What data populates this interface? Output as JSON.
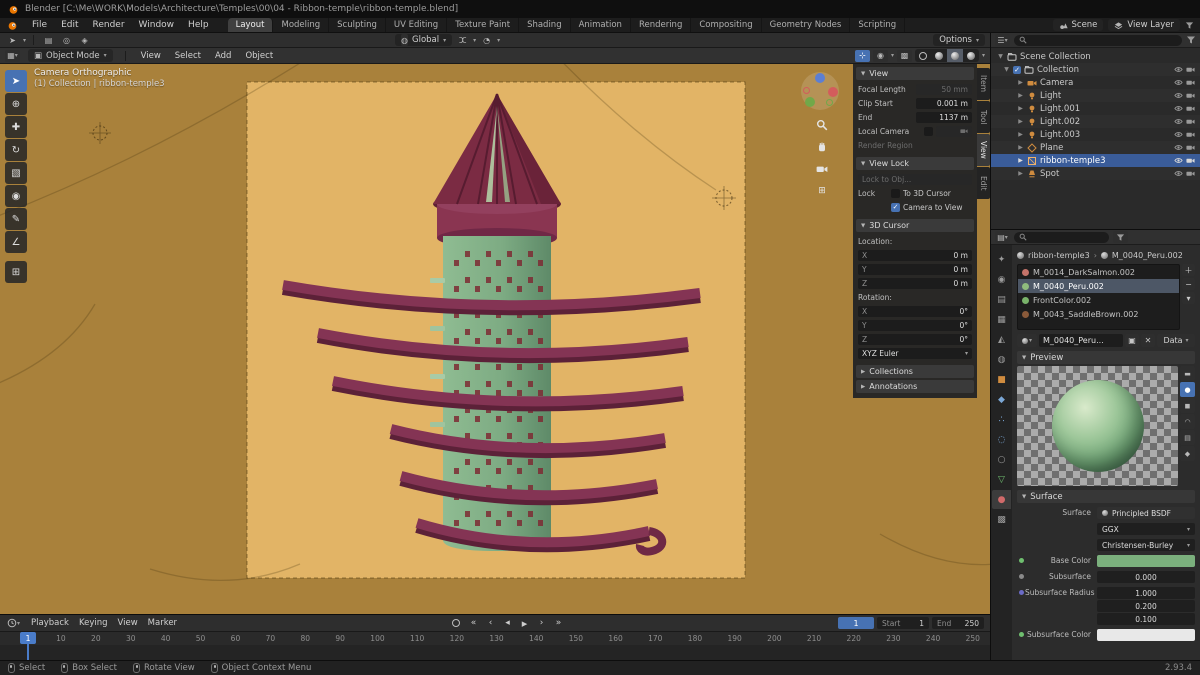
{
  "window": {
    "title": "Blender  [C:\\Me\\WORK\\Models\\Architecture\\Temples\\00\\04 - Ribbon-temple\\ribbon-temple.blend]"
  },
  "topbar": {
    "menus": [
      "File",
      "Edit",
      "Render",
      "Window",
      "Help"
    ],
    "workspaces": [
      "Layout",
      "Modeling",
      "Sculpting",
      "UV Editing",
      "Texture Paint",
      "Shading",
      "Animation",
      "Rendering",
      "Compositing",
      "Geometry Nodes",
      "Scripting"
    ],
    "active_workspace": "Layout",
    "scene": "Scene",
    "view_layer": "View Layer"
  },
  "tool_settings": {
    "orientation": "Global",
    "options": "Options"
  },
  "viewport": {
    "header": {
      "mode": "Object Mode",
      "menus": [
        "View",
        "Select",
        "Add",
        "Object"
      ]
    },
    "overlay": {
      "line1": "Camera Orthographic",
      "line2": "(1) Collection | ribbon-temple3"
    },
    "tools": [
      {
        "name": "select-box",
        "glyph": "➤"
      },
      {
        "name": "cursor",
        "glyph": "⊕"
      },
      {
        "name": "move",
        "glyph": "✚"
      },
      {
        "name": "rotate",
        "glyph": "↻"
      },
      {
        "name": "scale",
        "glyph": "▧"
      },
      {
        "name": "transform",
        "glyph": "◉"
      },
      {
        "name": "annotate",
        "glyph": "✎"
      },
      {
        "name": "measure",
        "glyph": "∠"
      },
      {
        "name": "add-cube",
        "glyph": "⊞"
      }
    ],
    "colors": {
      "background": "#a9813b",
      "camera_area": "#e2b466",
      "tower": "#7dab83",
      "ribbon": "#843454",
      "roof": "#7b2b43"
    }
  },
  "npanel": {
    "tabs": [
      "Item",
      "Tool",
      "View",
      "Edit"
    ],
    "active_tab": "View",
    "view": {
      "title": "View",
      "focal_length_label": "Focal Length",
      "focal_length": "50 mm",
      "clip_start_label": "Clip Start",
      "clip_start": "0.001 m",
      "clip_end_label": "End",
      "clip_end": "1137 m",
      "local_camera_label": "Local Camera",
      "render_region_label": "Render Region"
    },
    "view_lock": {
      "title": "View Lock",
      "lock_to_object": "Lock to Obj...",
      "lock_label": "Lock",
      "to_3d_cursor": "To 3D Cursor",
      "camera_to_view": "Camera to View"
    },
    "cursor3d": {
      "title": "3D Cursor",
      "location_label": "Location:",
      "rotation_label": "Rotation:",
      "axes": [
        "X",
        "Y",
        "Z"
      ],
      "location": [
        "0 m",
        "0 m",
        "0 m"
      ],
      "rotation": [
        "0°",
        "0°",
        "0°"
      ],
      "rotation_mode": "XYZ Euler"
    },
    "collections": {
      "title": "Collections"
    },
    "annotations": {
      "title": "Annotations"
    }
  },
  "outliner": {
    "scene_collection": "Scene Collection",
    "collection": "Collection",
    "items": [
      {
        "name": "Camera",
        "type": "camera"
      },
      {
        "name": "Light",
        "type": "light"
      },
      {
        "name": "Light.001",
        "type": "light"
      },
      {
        "name": "Light.002",
        "type": "light"
      },
      {
        "name": "Light.003",
        "type": "light"
      },
      {
        "name": "Plane",
        "type": "mesh"
      },
      {
        "name": "ribbon-temple3",
        "type": "mesh",
        "selected": true
      },
      {
        "name": "Spot",
        "type": "light"
      }
    ]
  },
  "properties": {
    "breadcrumb": {
      "object": "ribbon-temple3",
      "material": "M_0040_Peru.002"
    },
    "slots": [
      {
        "name": "M_0014_DarkSalmon.002",
        "color": "#c4736a"
      },
      {
        "name": "M_0040_Peru.002",
        "color": "#8fbb7d",
        "selected": true
      },
      {
        "name": "FrontColor.002",
        "color": "#79b36a"
      },
      {
        "name": "M_0043_SaddleBrown.002",
        "color": "#8a5a3a"
      }
    ],
    "datablock": {
      "name": "M_0040_Peru...",
      "data_button": "Data"
    },
    "preview": {
      "title": "Preview"
    },
    "surface": {
      "title": "Surface",
      "surface_label": "Surface",
      "shader": "Principled BSDF",
      "distribution": "GGX",
      "sss_method": "Christensen-Burley",
      "base_color_label": "Base Color",
      "base_color": "#7bb07d",
      "subsurface_label": "Subsurface",
      "subsurface": "0.000",
      "radius_label": "Subsurface Radius",
      "radius": [
        "1.000",
        "0.200",
        "0.100"
      ],
      "sss_color_label": "Subsurface Color",
      "sss_color": "#e8e8e8"
    }
  },
  "timeline": {
    "menus": [
      "Playback",
      "Keying",
      "View",
      "Marker"
    ],
    "transport": [
      "«",
      "‹",
      "◂",
      "▸",
      "›",
      "»"
    ],
    "current_frame": "1",
    "start_label": "Start",
    "start": "1",
    "end_label": "End",
    "end": "250",
    "ticks": [
      "1",
      "10",
      "20",
      "30",
      "40",
      "50",
      "60",
      "70",
      "80",
      "90",
      "100",
      "110",
      "120",
      "130",
      "140",
      "150",
      "160",
      "170",
      "180",
      "190",
      "200",
      "210",
      "220",
      "230",
      "240",
      "250"
    ]
  },
  "statusbar": {
    "items": [
      "Select",
      "Box Select",
      "Rotate View",
      "Object Context Menu"
    ],
    "version": "2.93.4"
  },
  "colors": {
    "accent": "#4772b3",
    "selection": "#3a5c99"
  }
}
